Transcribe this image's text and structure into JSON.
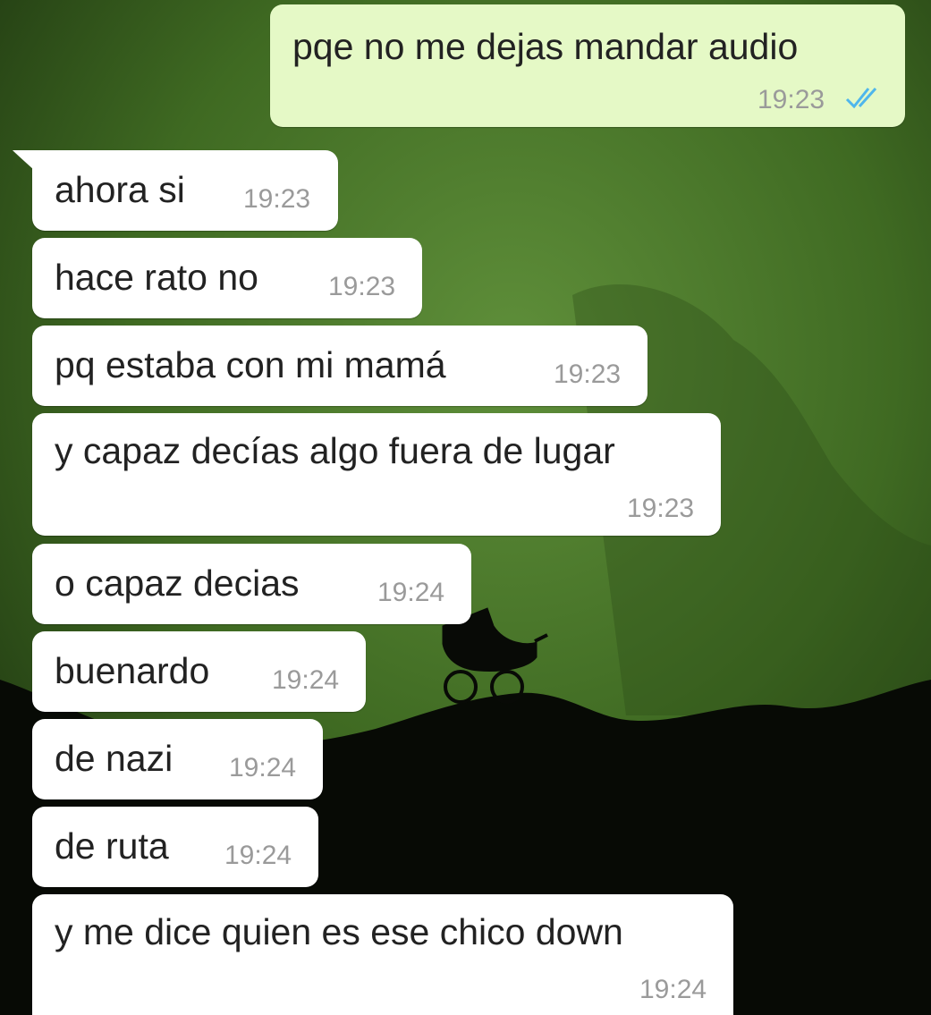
{
  "messages": [
    {
      "direction": "out",
      "text": "pqe no me dejas mandar audio",
      "time": "19:23",
      "status": "read"
    },
    {
      "direction": "in",
      "text": "ahora si",
      "time": "19:23"
    },
    {
      "direction": "in",
      "text": "hace rato no",
      "time": "19:23"
    },
    {
      "direction": "in",
      "text": "pq estaba con mi mamá",
      "time": "19:23"
    },
    {
      "direction": "in",
      "text": "y capaz decías algo fuera de lugar",
      "time": "19:23"
    },
    {
      "direction": "in",
      "text": "o capaz decias",
      "time": "19:24"
    },
    {
      "direction": "in",
      "text": "buenardo",
      "time": "19:24"
    },
    {
      "direction": "in",
      "text": "de nazi",
      "time": "19:24"
    },
    {
      "direction": "in",
      "text": "de ruta",
      "time": "19:24"
    },
    {
      "direction": "in",
      "text": "y me dice quien es ese chico down",
      "time": "19:24"
    }
  ],
  "colors": {
    "outgoing_bubble": "#e5f9c6",
    "incoming_bubble": "#ffffff",
    "read_ticks": "#4fb6ec",
    "wallpaper": "#4a7a2a"
  },
  "icons": {
    "read_receipt": "double-check-icon",
    "wallpaper_object": "baby-carriage-silhouette"
  }
}
